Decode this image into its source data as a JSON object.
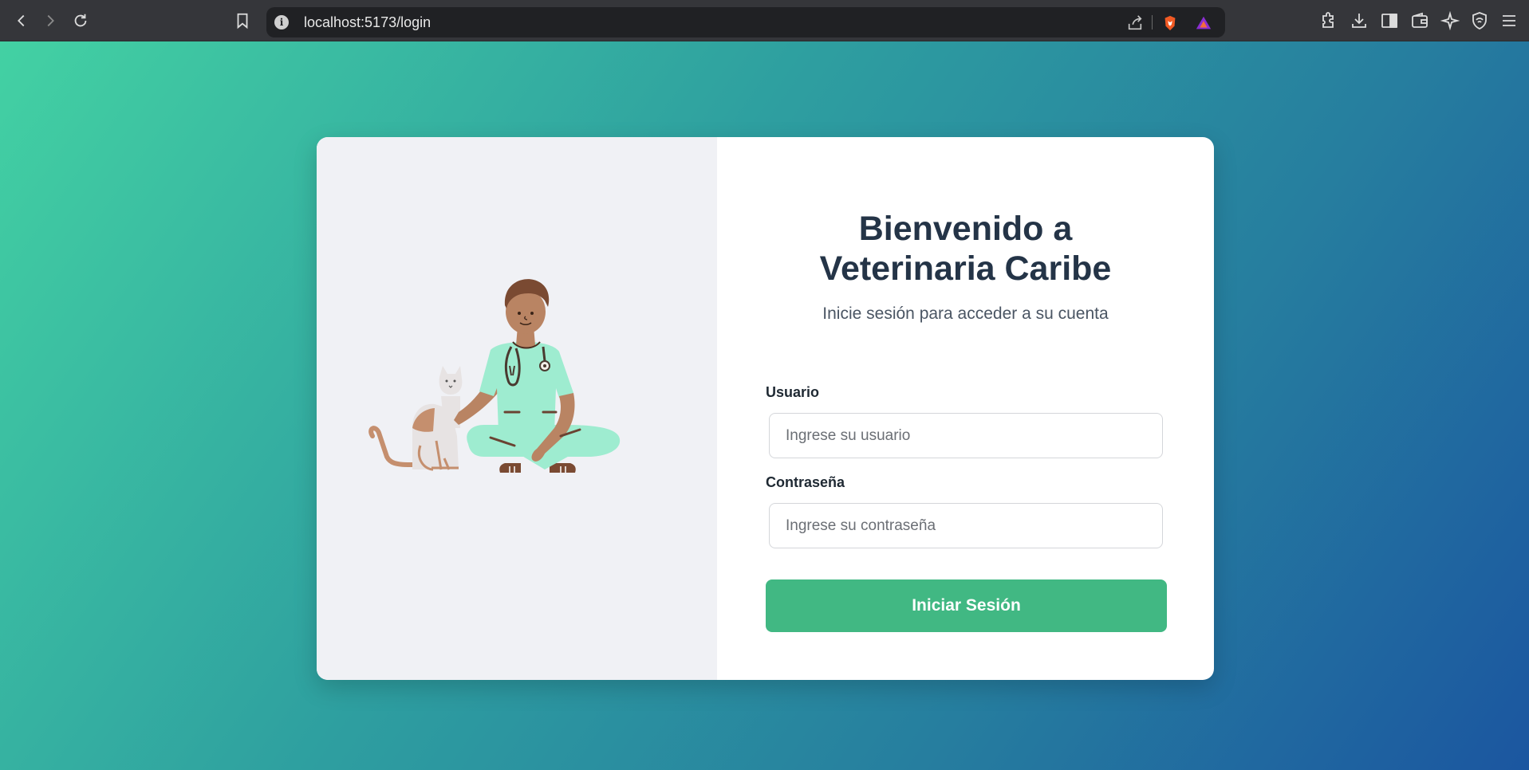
{
  "browser": {
    "url": "localhost:5173/login",
    "icons": [
      "back-icon",
      "forward-icon",
      "reload-icon",
      "bookmark-icon",
      "site-info-icon",
      "share-icon",
      "brave-shields-icon",
      "brave-rewards-icon",
      "extensions-icon",
      "downloads-icon",
      "sidebar-icon",
      "wallet-icon",
      "leo-ai-icon",
      "vpn-icon",
      "menu-icon"
    ]
  },
  "login": {
    "title_line1": "Bienvenido a",
    "title_line2": "Veterinaria Caribe",
    "subtitle": "Inicie sesión para acceder a su cuenta",
    "username_label": "Usuario",
    "username_placeholder": "Ingrese su usuario",
    "username_value": "",
    "password_label": "Contraseña",
    "password_placeholder": "Ingrese su contraseña",
    "password_value": "",
    "submit_label": "Iniciar Sesión"
  },
  "colors": {
    "gradient_start": "#43d1a3",
    "gradient_end": "#1b56a0",
    "button": "#41b883",
    "title": "#243447",
    "scrubs": "#9eecd0"
  }
}
